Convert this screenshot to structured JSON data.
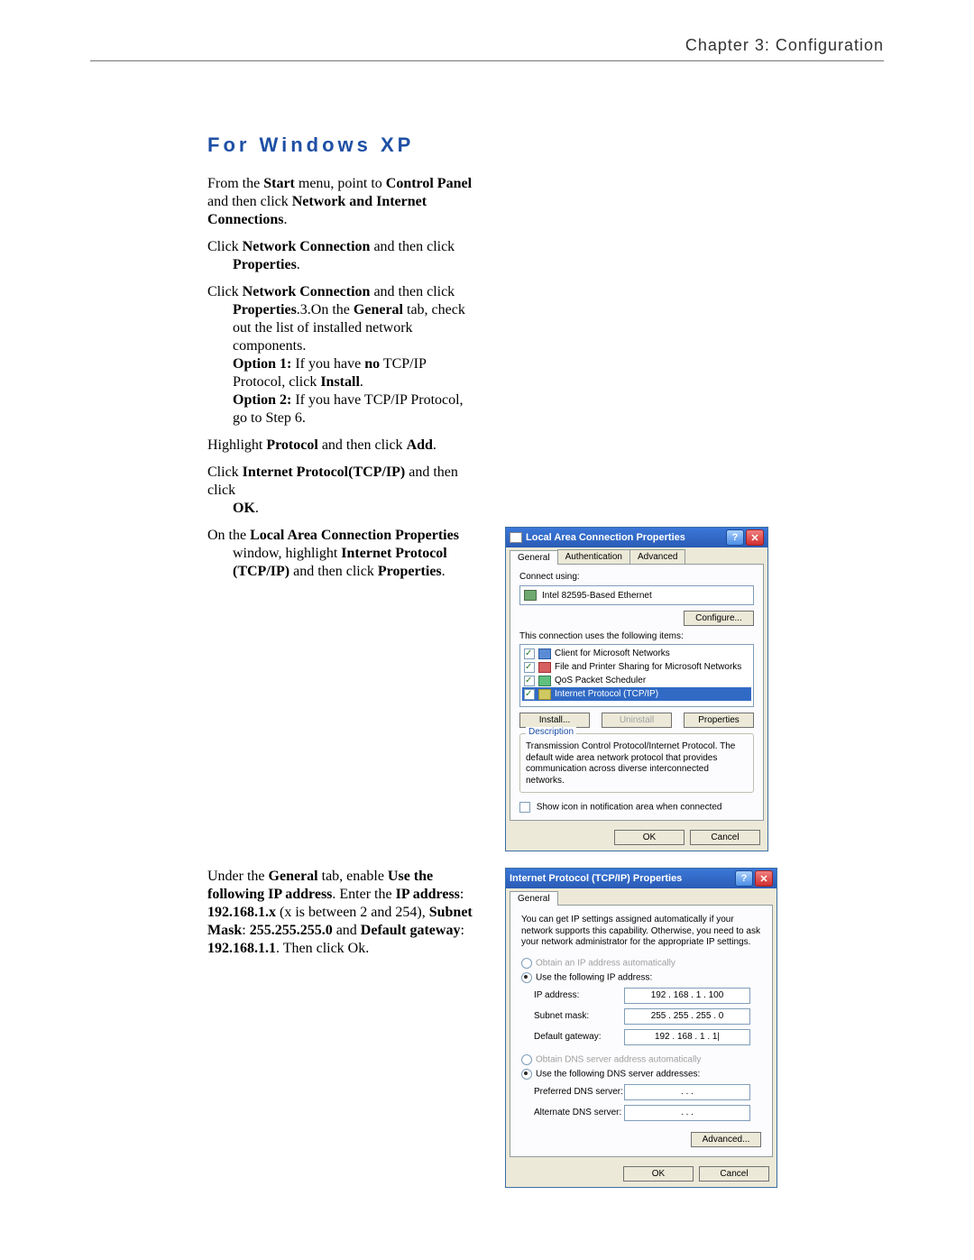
{
  "header": "Chapter 3: Configuration",
  "section_title": "For Windows XP",
  "steps": {
    "s1a": "From the ",
    "s1b": "Start",
    "s1c": " menu, point to ",
    "s1d": "Control Panel",
    "s1e": " and then click ",
    "s1f": "Network and Internet Connections",
    "s1g": ".",
    "s2a": "Click ",
    "s2b": "Network Connection",
    "s2c": " and then click ",
    "s2d": "Properties",
    "s2e": ".",
    "s3a": "Click ",
    "s3b": "Network Connection",
    "s3c": " and then click ",
    "s3d": "Properties",
    "s3e": ".3.On the ",
    "s3f": "General",
    "s3g": " tab, check out the list of installed network components.",
    "s3h": "Option 1:",
    "s3i": " If you have ",
    "s3j": "no",
    "s3k": " TCP/IP Protocol, click ",
    "s3l": "Install",
    "s3m": ".",
    "s3n": "Option 2:",
    "s3o": " If you have TCP/IP Protocol, go to Step 6.",
    "s4a": "Highlight ",
    "s4b": "Protocol",
    "s4c": " and then click ",
    "s4d": "Add",
    "s4e": ".",
    "s5a": "Click ",
    "s5b": "Internet Protocol(TCP/IP)",
    "s5c": " and then click ",
    "s5d": "OK",
    "s5e": ".",
    "s6a": "On the ",
    "s6b": "Local Area Connection Properties",
    "s6c": " window, highlight ",
    "s6d": "Internet Protocol (TCP/IP)",
    "s6e": " and then click ",
    "s6f": "Properties",
    "s6g": ".",
    "s7a": "Under the ",
    "s7b": "General",
    "s7c": " tab, enable ",
    "s7d": "Use the following IP address",
    "s7e": ". Enter the ",
    "s7f": "IP address",
    "s7g": ": ",
    "s7h": "192.168.1.x",
    "s7i": " (x is between 2 and 254), ",
    "s7j": "Subnet Mask",
    "s7k": ": ",
    "s7l": "255.255.255.0",
    "s7m": " and ",
    "s7n": "Default gateway",
    "s7o": ": ",
    "s7p": "192.168.1.1",
    "s7q": ". Then click Ok."
  },
  "dlg1": {
    "title": "Local Area Connection Properties",
    "tabs": {
      "general": "General",
      "auth": "Authentication",
      "adv": "Advanced"
    },
    "connect_using": "Connect using:",
    "adapter": "Intel 82595-Based Ethernet",
    "configure": "Configure...",
    "uses_items": "This connection uses the following items:",
    "items": {
      "client": "Client for Microsoft Networks",
      "fps": "File and Printer Sharing for Microsoft Networks",
      "qos": "QoS Packet Scheduler",
      "tcpip": "Internet Protocol (TCP/IP)"
    },
    "install": "Install...",
    "uninstall": "Uninstall",
    "properties": "Properties",
    "desc_legend": "Description",
    "desc_text": "Transmission Control Protocol/Internet Protocol. The default wide area network protocol that provides communication across diverse interconnected networks.",
    "show_icon": "Show icon in notification area when connected",
    "ok": "OK",
    "cancel": "Cancel",
    "help": "?",
    "close": "✕"
  },
  "dlg2": {
    "title": "Internet Protocol (TCP/IP) Properties",
    "tab": "General",
    "intro": "You can get IP settings assigned automatically if your network supports this capability. Otherwise, you need to ask your network administrator for the appropriate IP settings.",
    "auto_ip": "Obtain an IP address automatically",
    "use_ip": "Use the following IP address:",
    "ip_label": "IP address:",
    "ip_value": "192 . 168 .   1  . 100",
    "mask_label": "Subnet mask:",
    "mask_value": "255 . 255 . 255 .   0",
    "gw_label": "Default gateway:",
    "gw_value": "192 . 168 .   1  .   1|",
    "auto_dns": "Obtain DNS server address automatically",
    "use_dns": "Use the following DNS server addresses:",
    "pref_dns": "Preferred DNS server:",
    "alt_dns": "Alternate DNS server:",
    "dots": ".        .        .",
    "advanced": "Advanced...",
    "ok": "OK",
    "cancel": "Cancel",
    "help": "?",
    "close": "✕"
  }
}
